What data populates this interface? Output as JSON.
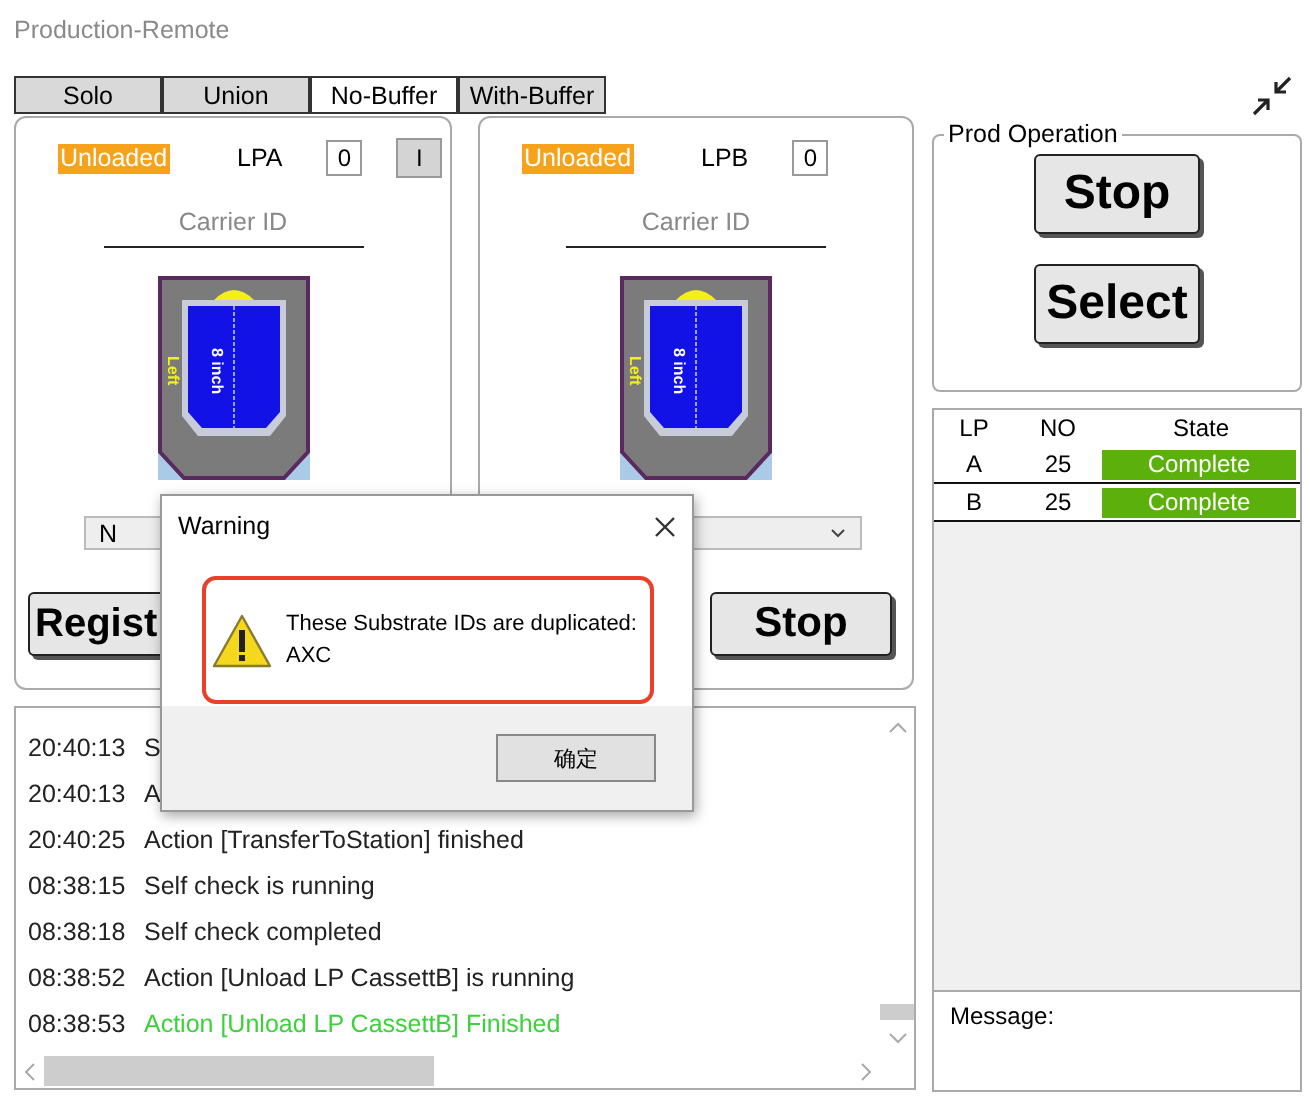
{
  "window": {
    "title": "Production-Remote"
  },
  "tabs": [
    {
      "label": "Solo",
      "selected": false
    },
    {
      "label": "Union",
      "selected": false
    },
    {
      "label": "No-Buffer",
      "selected": true
    },
    {
      "label": "With-Buffer",
      "selected": false
    }
  ],
  "load_ports": [
    {
      "status": "Unloaded",
      "name": "LPA",
      "count": "0",
      "extra_button": "I",
      "carrier_label": "Carrier ID",
      "wafer_size": "8 inch",
      "side": "Left",
      "dropdown_value": "N",
      "button": "Regist"
    },
    {
      "status": "Unloaded",
      "name": "LPB",
      "count": "0",
      "carrier_label": "Carrier ID",
      "wafer_size": "8 inch",
      "side": "Left",
      "button": "Stop"
    }
  ],
  "prod_operation": {
    "title": "Prod Operation",
    "buttons": [
      "Stop",
      "Select"
    ]
  },
  "lp_table": {
    "columns": [
      "LP",
      "NO",
      "State"
    ],
    "rows": [
      {
        "lp": "A",
        "no": "25",
        "state": "Complete"
      },
      {
        "lp": "B",
        "no": "25",
        "state": "Complete"
      }
    ]
  },
  "message": {
    "label": "Message:"
  },
  "log": [
    {
      "time": "20:40:13",
      "text": "S",
      "kind": "normal"
    },
    {
      "time": "20:40:13",
      "text": "A",
      "kind": "normal"
    },
    {
      "time": "20:40:25",
      "text": "Action [TransferToStation] finished",
      "kind": "normal"
    },
    {
      "time": "08:38:15",
      "text": "Self check is running",
      "kind": "normal"
    },
    {
      "time": "08:38:18",
      "text": "Self check completed",
      "kind": "normal"
    },
    {
      "time": "08:38:52",
      "text": "Action [Unload LP CassettB] is running",
      "kind": "normal"
    },
    {
      "time": "08:38:53",
      "text": "Action [Unload LP CassettB] Finished",
      "kind": "success"
    }
  ],
  "dialog": {
    "title": "Warning",
    "lines": [
      "These Substrate IDs are duplicated:",
      "AXC"
    ],
    "button": "确定"
  }
}
